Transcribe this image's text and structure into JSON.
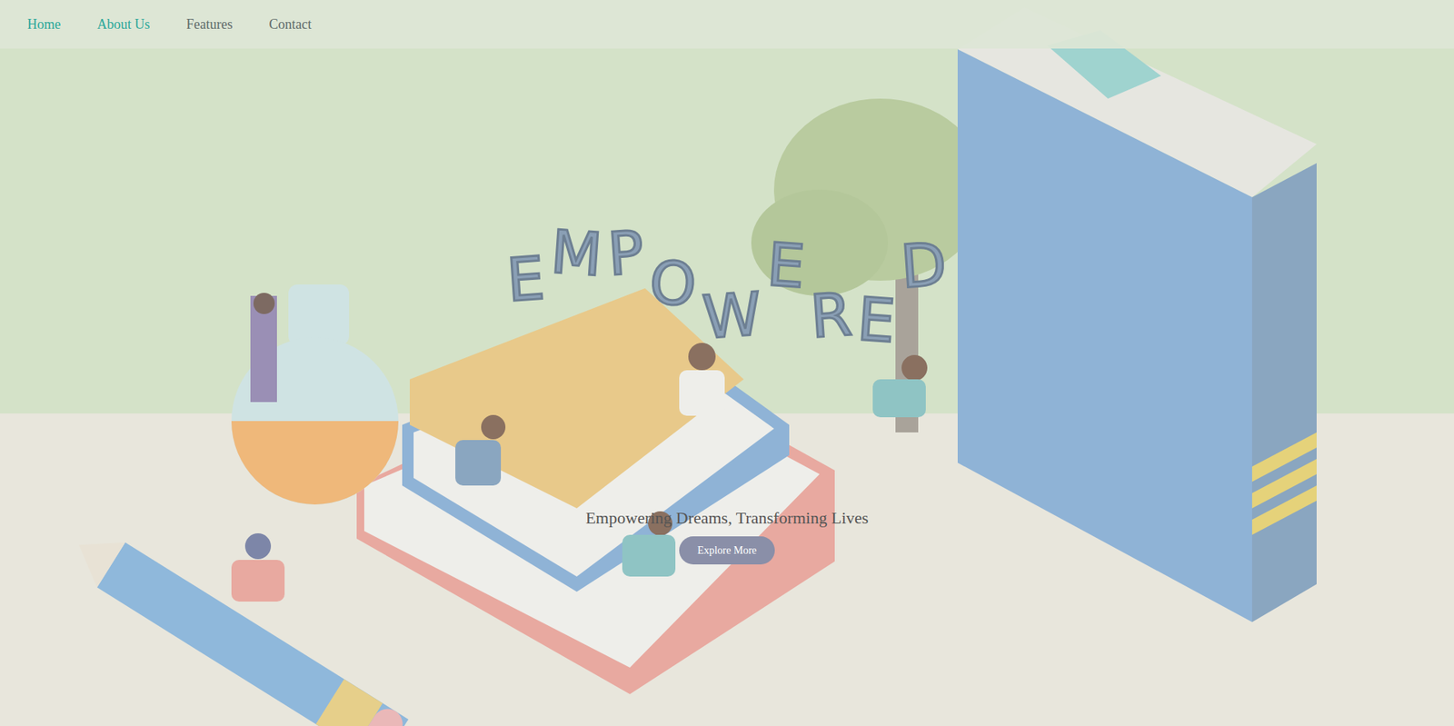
{
  "nav": {
    "items": [
      {
        "label": "Home",
        "active": true
      },
      {
        "label": "About Us",
        "active": true
      },
      {
        "label": "Features",
        "active": false
      },
      {
        "label": "Contact",
        "active": false
      }
    ]
  },
  "hero": {
    "title": "EMPOWERED",
    "subtitle": "Empowering Dreams, Transforming Lives",
    "button": "Explore More"
  }
}
